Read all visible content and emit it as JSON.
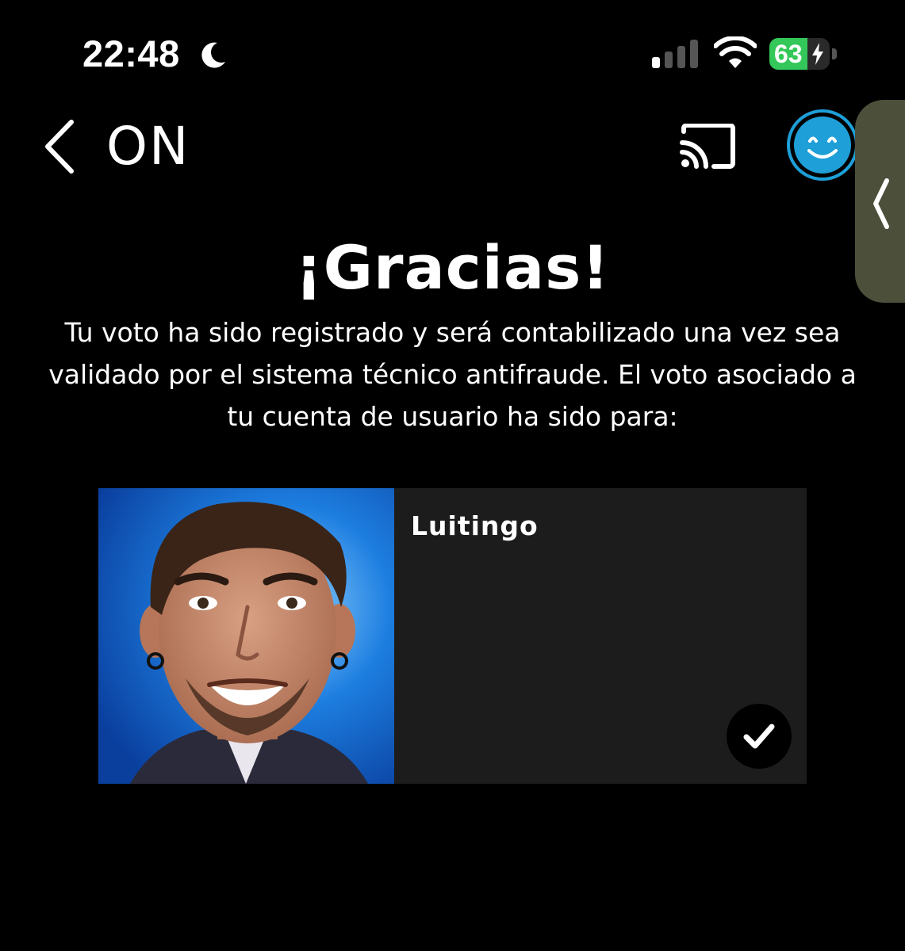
{
  "status_bar": {
    "time": "22:48",
    "battery_percent": 63,
    "battery_label": "63",
    "signal_bars_active": 1,
    "signal_bars_total": 4,
    "icons": [
      "moon-icon",
      "signal-icon",
      "wifi-icon",
      "battery-icon",
      "charging-bolt-icon"
    ]
  },
  "nav": {
    "title": "ON",
    "icons": [
      "chevron-left-icon",
      "cast-icon",
      "smiley-avatar-icon"
    ]
  },
  "content": {
    "heading": "¡Gracias!",
    "message": "Tu voto ha sido registrado y será contabilizado una vez sea validado por el sistema técnico antifraude. El voto asociado a tu cuenta de usuario ha sido para:",
    "candidate": {
      "name": "Luitingo",
      "selected": true
    }
  },
  "colors": {
    "background": "#000000",
    "card_background": "#1c1c1c",
    "avatar_accent": "#1e9fd8",
    "battery_green": "#34c759",
    "side_handle": "#4c4f3a"
  }
}
